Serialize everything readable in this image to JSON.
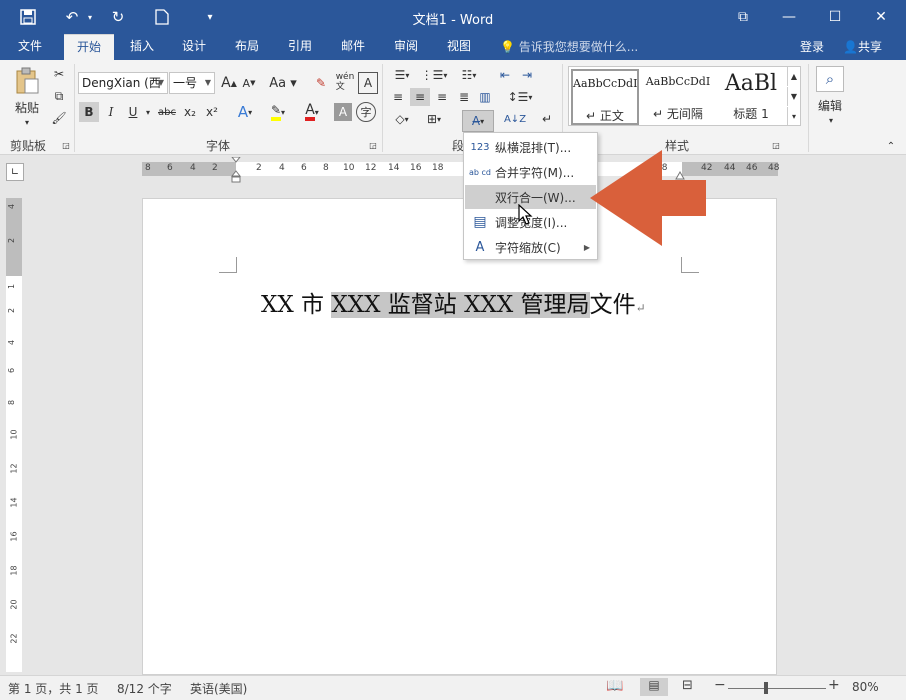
{
  "titlebar": {
    "title": "文档1 - Word",
    "save_icon": "save-icon",
    "undo_icon": "undo-icon",
    "redo_icon": "redo-icon",
    "new_icon": "new-doc-icon",
    "restore_label": "⧉",
    "minimize_label": "—",
    "maximize_label": "☐",
    "close_label": "✕"
  },
  "tabs": [
    "文件",
    "开始",
    "插入",
    "设计",
    "布局",
    "引用",
    "邮件",
    "审阅",
    "视图"
  ],
  "active_tab": "开始",
  "tell_me": "告诉我您想要做什么...",
  "login": "登录",
  "share": "共享",
  "ribbon": {
    "clipboard": {
      "label": "剪贴板",
      "paste": "粘贴"
    },
    "font": {
      "label": "字体",
      "font_name": "DengXian (西",
      "font_size": "一号",
      "buttons": [
        "B",
        "I",
        "U",
        "abc",
        "x₂",
        "x²"
      ]
    },
    "paragraph": {
      "label": "段"
    },
    "styles": {
      "label": "样式",
      "items": [
        {
          "sample": "AaBbCcDdI",
          "name": "正文"
        },
        {
          "sample": "AaBbCcDdI",
          "name": "无间隔"
        },
        {
          "sample": "AaBl",
          "name": "标题 1"
        }
      ]
    },
    "editing": {
      "label": "编辑"
    }
  },
  "ruler": {
    "ticks": [
      "8",
      "6",
      "4",
      "2",
      "2",
      "4",
      "6",
      "8",
      "10",
      "12",
      "14",
      "16",
      "18",
      "38",
      "42",
      "44",
      "46",
      "48"
    ]
  },
  "vruler": {
    "ticks": [
      "4",
      "2",
      "1",
      "2",
      "4",
      "6",
      "8",
      "10",
      "12",
      "14",
      "16",
      "18",
      "20",
      "22"
    ]
  },
  "document": {
    "pre": "XX 市 ",
    "highlight": "XXX 监督站 XXX 管理局",
    "post": "文件",
    "para_mark": "↵"
  },
  "menu": {
    "items": [
      {
        "icon": "123",
        "label": "纵横混排(T)...",
        "hover": false,
        "submenu": false
      },
      {
        "icon": "ab cd",
        "label": "合并字符(M)...",
        "hover": false,
        "submenu": false
      },
      {
        "icon": "",
        "label": "双行合一(W)...",
        "hover": true,
        "submenu": false
      },
      {
        "icon": "▤",
        "label": "调整宽度(I)...",
        "hover": false,
        "submenu": false
      },
      {
        "icon": "A",
        "label": "字符缩放(C)",
        "hover": false,
        "submenu": true
      }
    ]
  },
  "status": {
    "page": "第 1 页，共 1 页",
    "words": "8/12 个字",
    "language": "英语(美国)",
    "zoom": "80%",
    "zoom_value": 80
  },
  "colors": {
    "brand": "#2b579a",
    "arrow": "#d9603b",
    "highlight": "#c6c6c6"
  }
}
